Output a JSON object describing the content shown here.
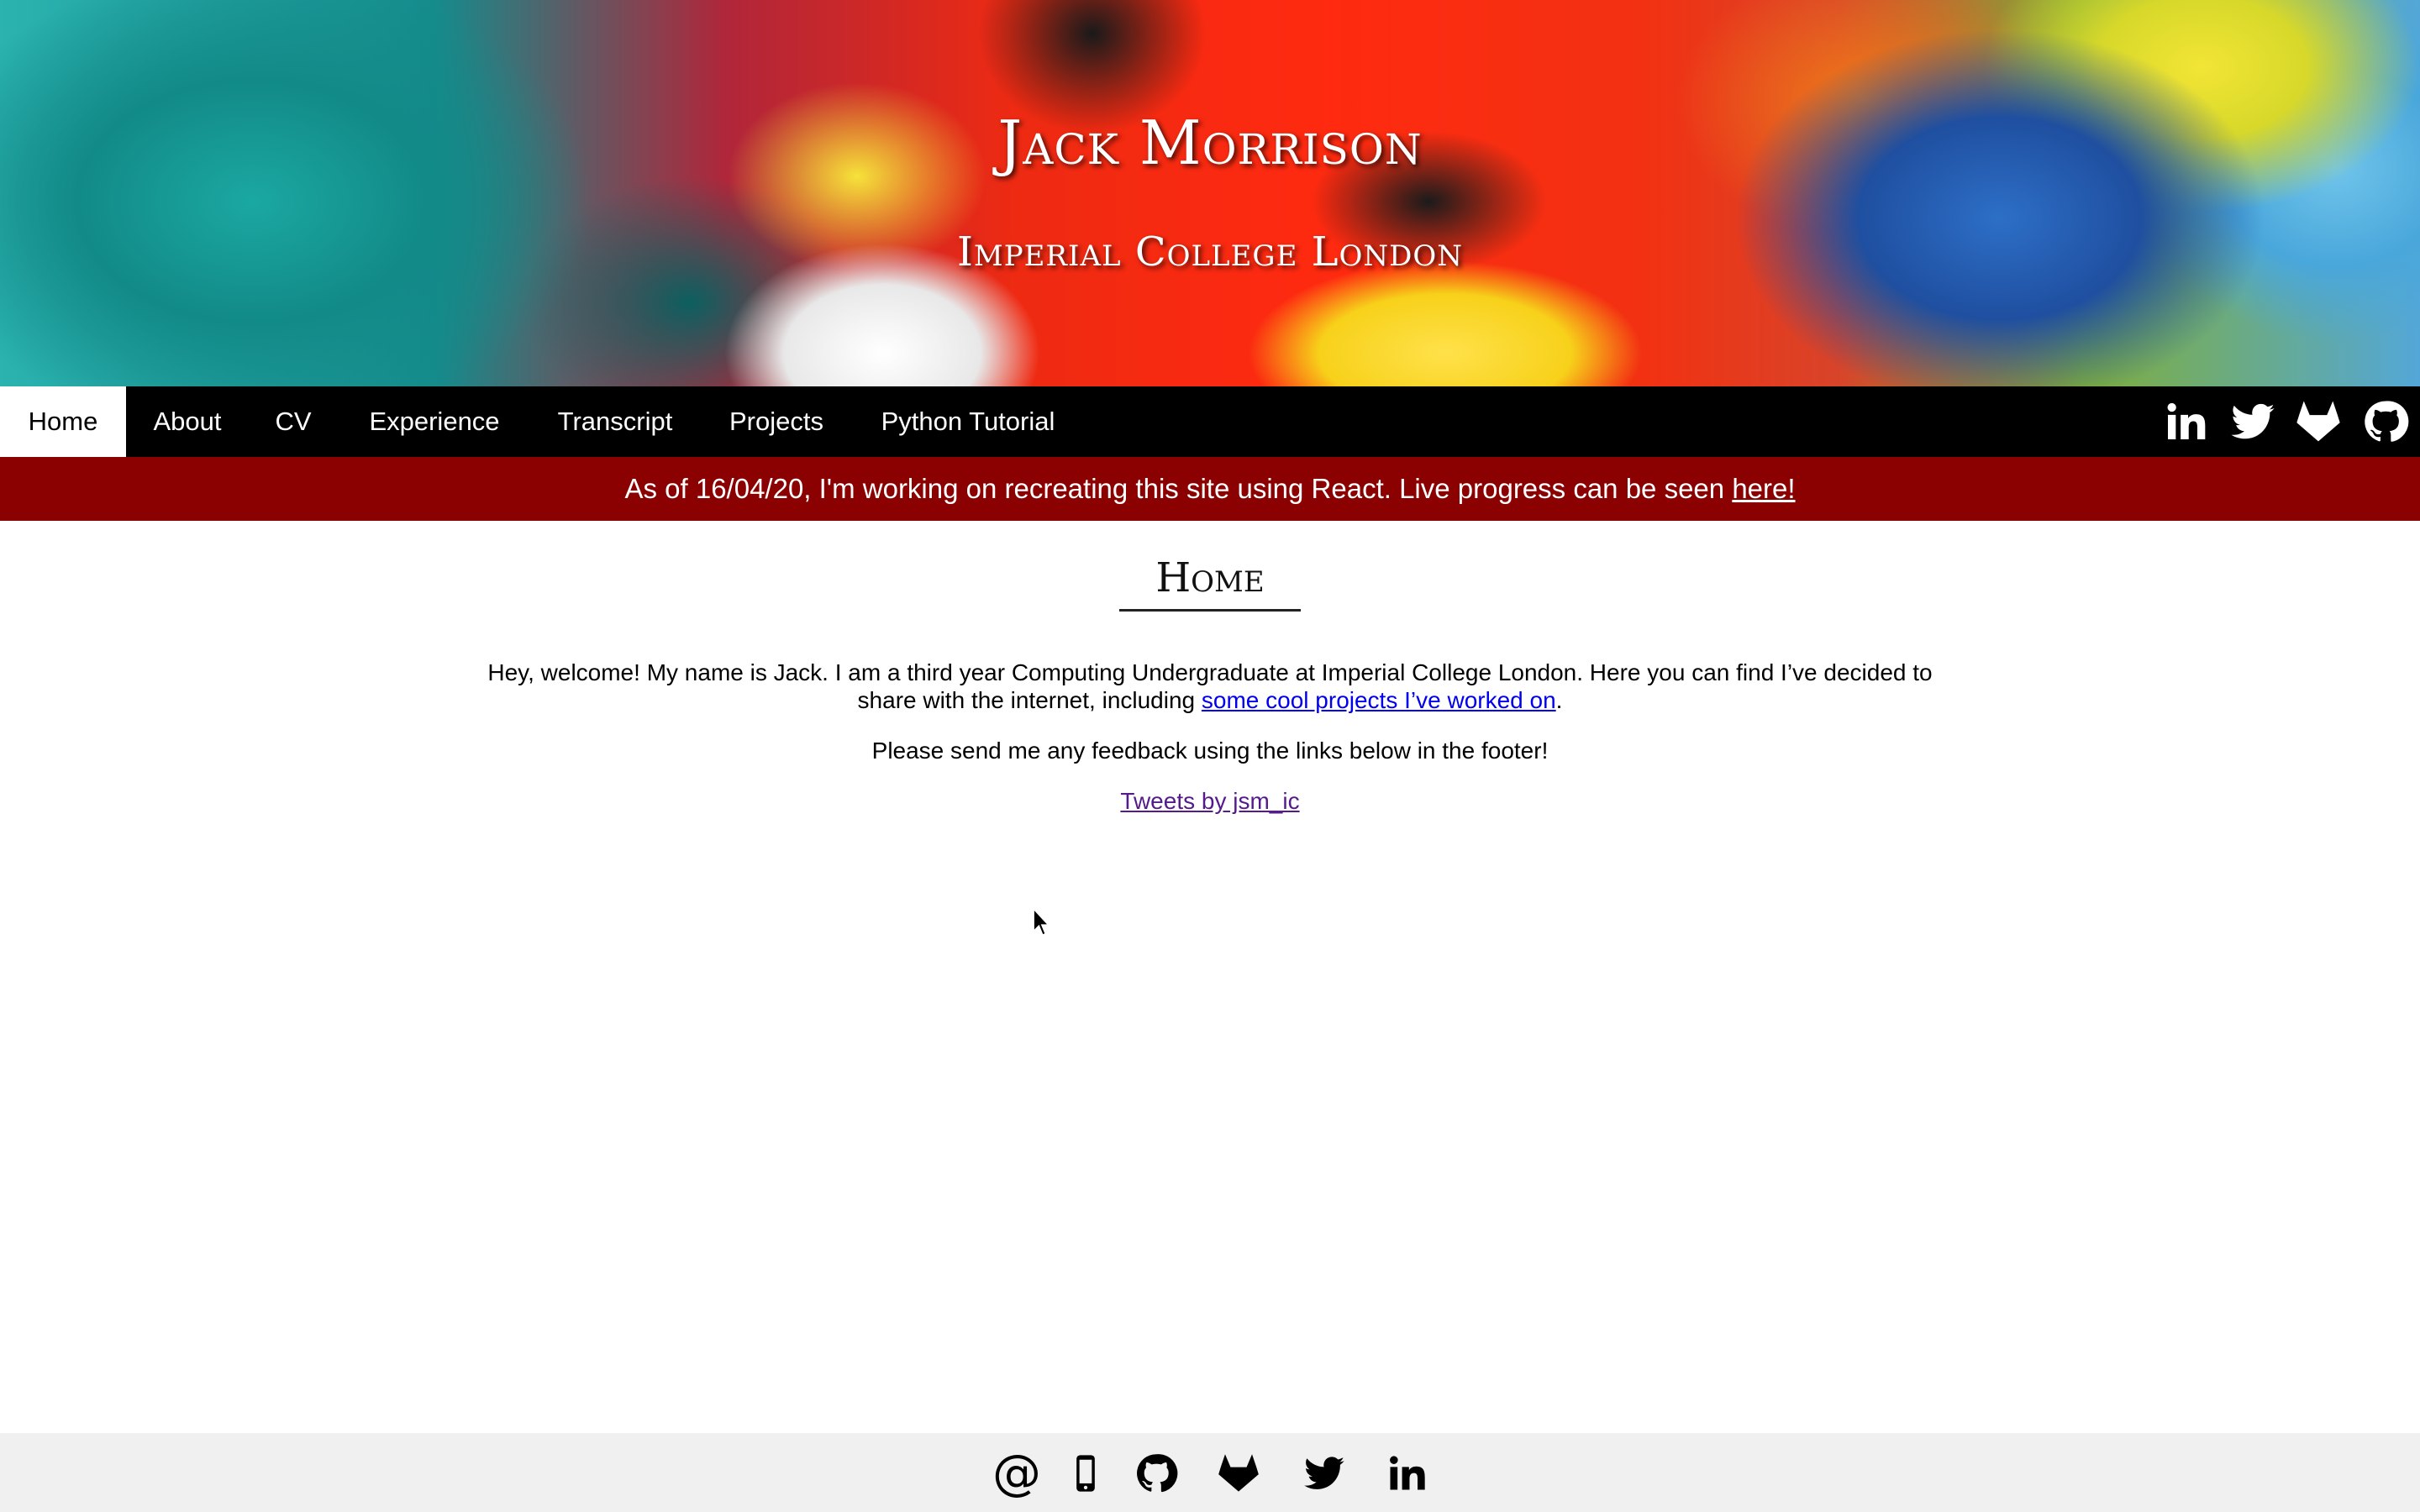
{
  "header": {
    "name": "Jack Morrison",
    "institution": "Imperial College London"
  },
  "nav": {
    "items": [
      {
        "label": "Home",
        "active": true
      },
      {
        "label": "About"
      },
      {
        "label": "CV"
      },
      {
        "label": "Experience"
      },
      {
        "label": "Transcript"
      },
      {
        "label": "Projects"
      },
      {
        "label": "Python Tutorial"
      }
    ],
    "social_icons": [
      "linkedin-icon",
      "twitter-icon",
      "gitlab-icon",
      "github-icon"
    ]
  },
  "notice": {
    "text": "As of 16/04/20, I'm working on recreating this site using React. Live progress can be seen ",
    "link_label": "here!"
  },
  "main": {
    "title": "Home",
    "intro_text": "Hey, welcome! My name is Jack. I am a third year Computing Undergraduate at Imperial College London. Here you can find I’ve decided to share with the internet, including ",
    "intro_link": "some cool projects I’ve worked on",
    "intro_end": ".",
    "feedback": "Please send me any feedback using the links below in the footer!",
    "tweets_link": "Tweets by jsm_ic"
  },
  "footer": {
    "email_glyph": "@",
    "icons": [
      "email-icon",
      "phone-icon",
      "github-icon",
      "gitlab-icon",
      "twitter-icon",
      "linkedin-icon"
    ]
  },
  "colors": {
    "nav_bg": "#000000",
    "notice_bg": "#8b0000",
    "footer_bg": "#f0f0f0",
    "link": "#0000ee",
    "visited_link": "#551a8b"
  }
}
